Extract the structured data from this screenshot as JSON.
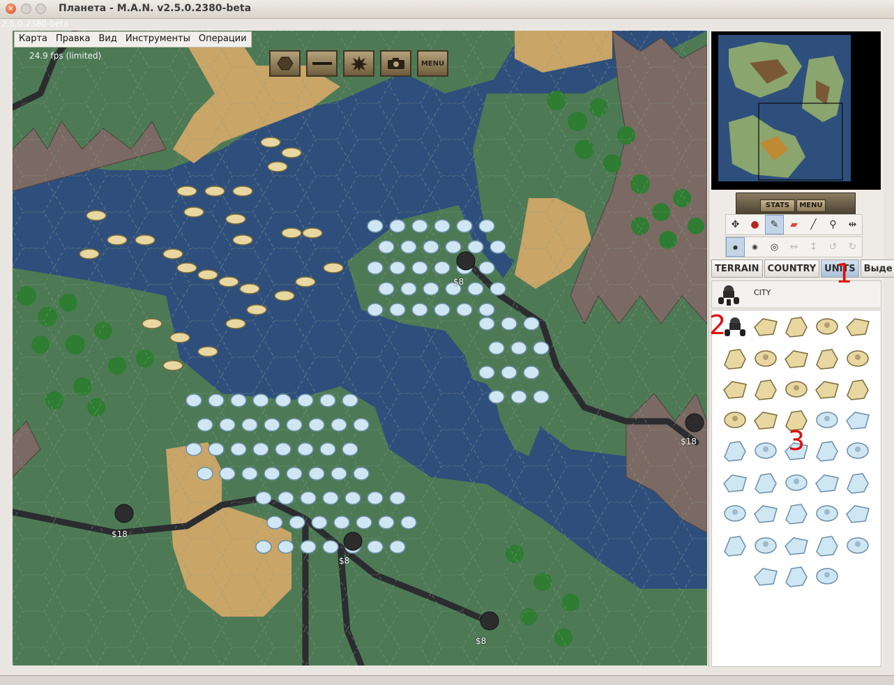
{
  "window": {
    "title": "Планета - M.A.N. v2.5.0.2380-beta",
    "ghost_text": "2.5.0.2380-beta"
  },
  "menu": {
    "items": [
      "Карта",
      "Правка",
      "Вид",
      "Инструменты",
      "Операции"
    ]
  },
  "map": {
    "fps": "24.9 fps (limited)",
    "toolbar": {
      "hex_icon": "hexagon-icon",
      "line_icon": "line-icon",
      "explosion_icon": "explosion-icon",
      "camera_icon": "camera-icon",
      "menu_label": "MENU"
    },
    "city_prices": [
      "$8",
      "$18",
      "$18",
      "$8",
      "$8"
    ]
  },
  "panel": {
    "stats_label": "STATS",
    "menu_label": "MENU",
    "tools_row1": [
      "move-icon",
      "paint-blob-icon",
      "brush-icon",
      "eraser-icon",
      "pencil-icon",
      "eyedropper-icon",
      "stretch-icon"
    ],
    "tools_row2": [
      "dot-small-icon",
      "dot-medium-icon",
      "dot-large-icon",
      "flip-horizontal-icon",
      "flip-vertical-icon",
      "rotate-ccw-icon",
      "rotate-cw-icon"
    ],
    "tabs": [
      "TERRAIN",
      "COUNTRY",
      "UNITS",
      "Выде"
    ],
    "active_tab": "UNITS",
    "selected_label": "CITY",
    "annotations": [
      "1",
      "2",
      "3"
    ]
  },
  "colors": {
    "water": "#2e4f7c",
    "grass": "#4d7a55",
    "sand": "#c9a567",
    "mountain": "#7a6a63",
    "road": "#35363a",
    "gold_units": "#e8d7a0",
    "ice_units": "#cfe6f3"
  }
}
